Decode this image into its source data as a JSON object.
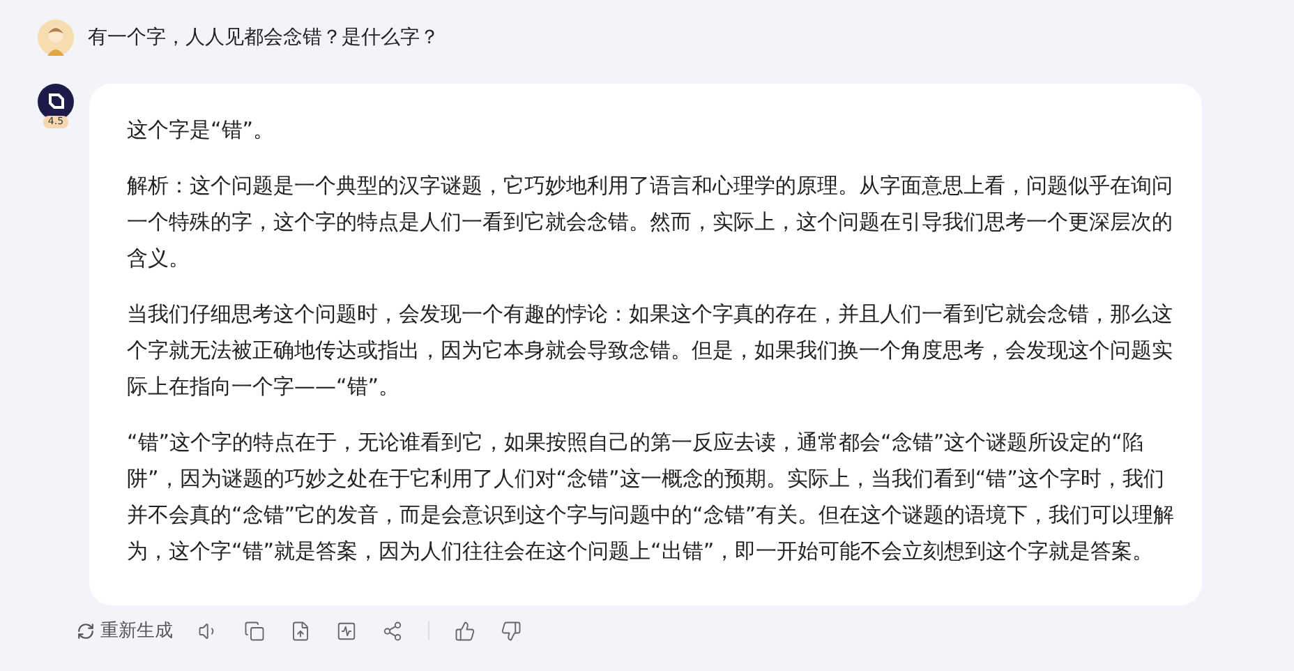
{
  "question": {
    "text": "有一个字，人人见都会念错？是什么字？"
  },
  "answer": {
    "model_badge": "4.5",
    "paragraphs": [
      "这个字是“错”。",
      "解析：这个问题是一个典型的汉字谜题，它巧妙地利用了语言和心理学的原理。从字面意思上看，问题似乎在询问一个特殊的字，这个字的特点是人们一看到它就会念错。然而，实际上，这个问题在引导我们思考一个更深层次的含义。",
      "当我们仔细思考这个问题时，会发现一个有趣的悖论：如果这个字真的存在，并且人们一看到它就会念错，那么这个字就无法被正确地传达或指出，因为它本身就会导致念错。但是，如果我们换一个角度思考，会发现这个问题实际上在指向一个字——“错”。",
      "“错”这个字的特点在于，无论谁看到它，如果按照自己的第一反应去读，通常都会“念错”这个谜题所设定的“陷阱”，因为谜题的巧妙之处在于它利用了人们对“念错”这一概念的预期。实际上，当我们看到“错”这个字时，我们并不会真的“念错”它的发音，而是会意识到这个字与问题中的“念错”有关。但在这个谜题的语境下，我们可以理解为，这个字“错”就是答案，因为人们往往会在这个问题上“出错”，即一开始可能不会立刻想到这个字就是答案。"
    ]
  },
  "actions": {
    "regenerate": "重新生成",
    "icons": [
      {
        "kind": "speaker"
      },
      {
        "kind": "copy"
      },
      {
        "kind": "export"
      },
      {
        "kind": "chart"
      },
      {
        "kind": "share"
      },
      {
        "kind": "divider"
      },
      {
        "kind": "like"
      },
      {
        "kind": "dislike"
      }
    ]
  }
}
